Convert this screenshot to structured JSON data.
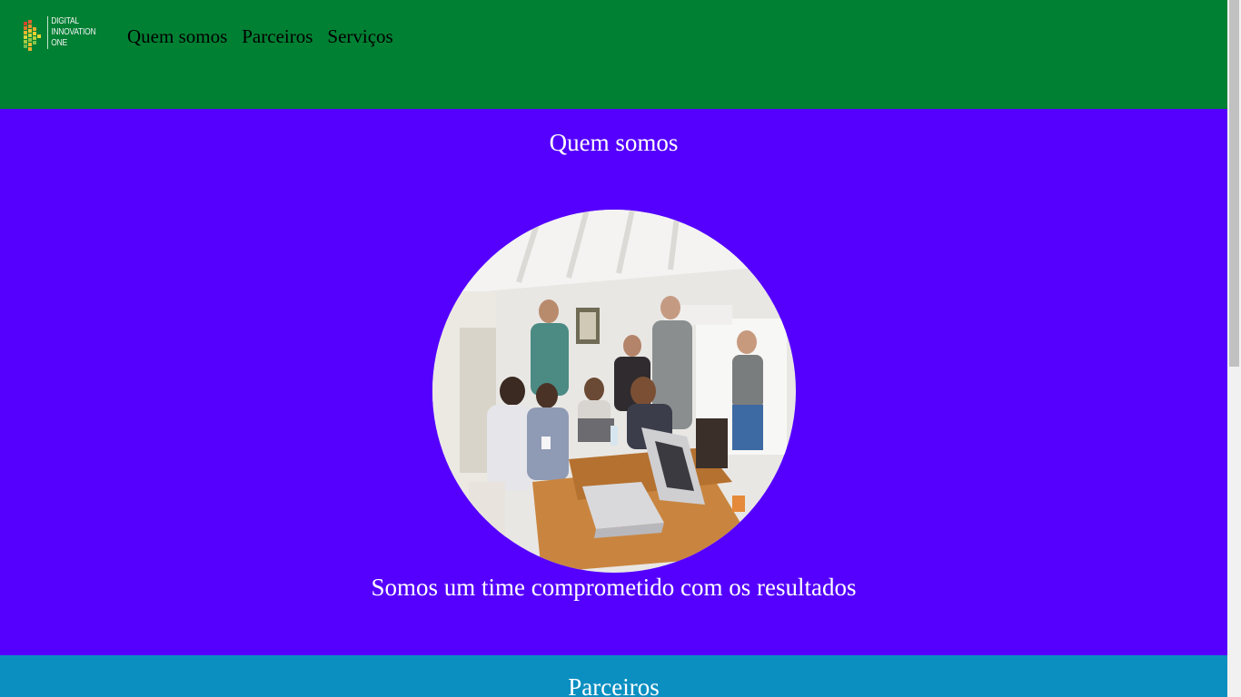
{
  "header": {
    "logo": {
      "lines": [
        "DIGITAL",
        "INNOVATION",
        "ONE"
      ],
      "icon": "dio-logo-icon"
    },
    "nav": [
      {
        "label": "Quem somos"
      },
      {
        "label": "Parceiros"
      },
      {
        "label": "Serviços"
      }
    ]
  },
  "about": {
    "title": "Quem somos",
    "image": "team-photo",
    "tagline": "Somos um time comprometido com os resultados"
  },
  "partners": {
    "title": "Parceiros"
  },
  "colors": {
    "header": "#008033",
    "about": "#5500ff",
    "partners": "#0b8fc1"
  }
}
